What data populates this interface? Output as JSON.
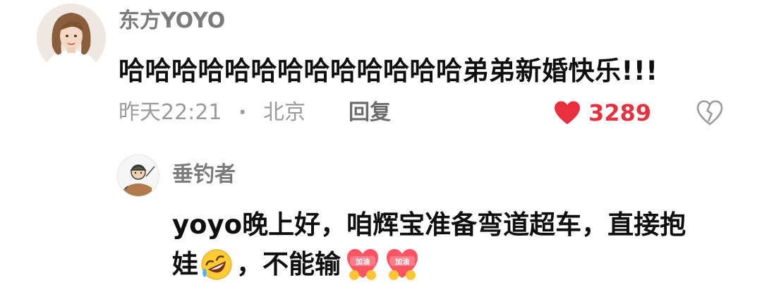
{
  "comment": {
    "username": "东方YOYO",
    "text": "哈哈哈哈哈哈哈哈哈哈哈哈哈弟弟新婚快乐!!!",
    "time": "昨天22:21",
    "separator": "·",
    "location": "北京",
    "reply_label": "回复",
    "like_count": "3289",
    "colors": {
      "like": "#e8303f",
      "meta": "#9a9a9a",
      "username": "#7b7b7b"
    }
  },
  "reply": {
    "username": "垂钓者",
    "line1": "yoyo晚上好，咱辉宝准备弯道超车，直接抱",
    "line2_a": "娃",
    "line2_b": "，不能输",
    "emojis": [
      "rolling-laugh-emoji",
      "jiayou-emoji",
      "jiayou-emoji"
    ],
    "jiayou_text": "加油"
  },
  "icons": {
    "like": "heart-icon",
    "dislike": "broken-heart-icon"
  }
}
